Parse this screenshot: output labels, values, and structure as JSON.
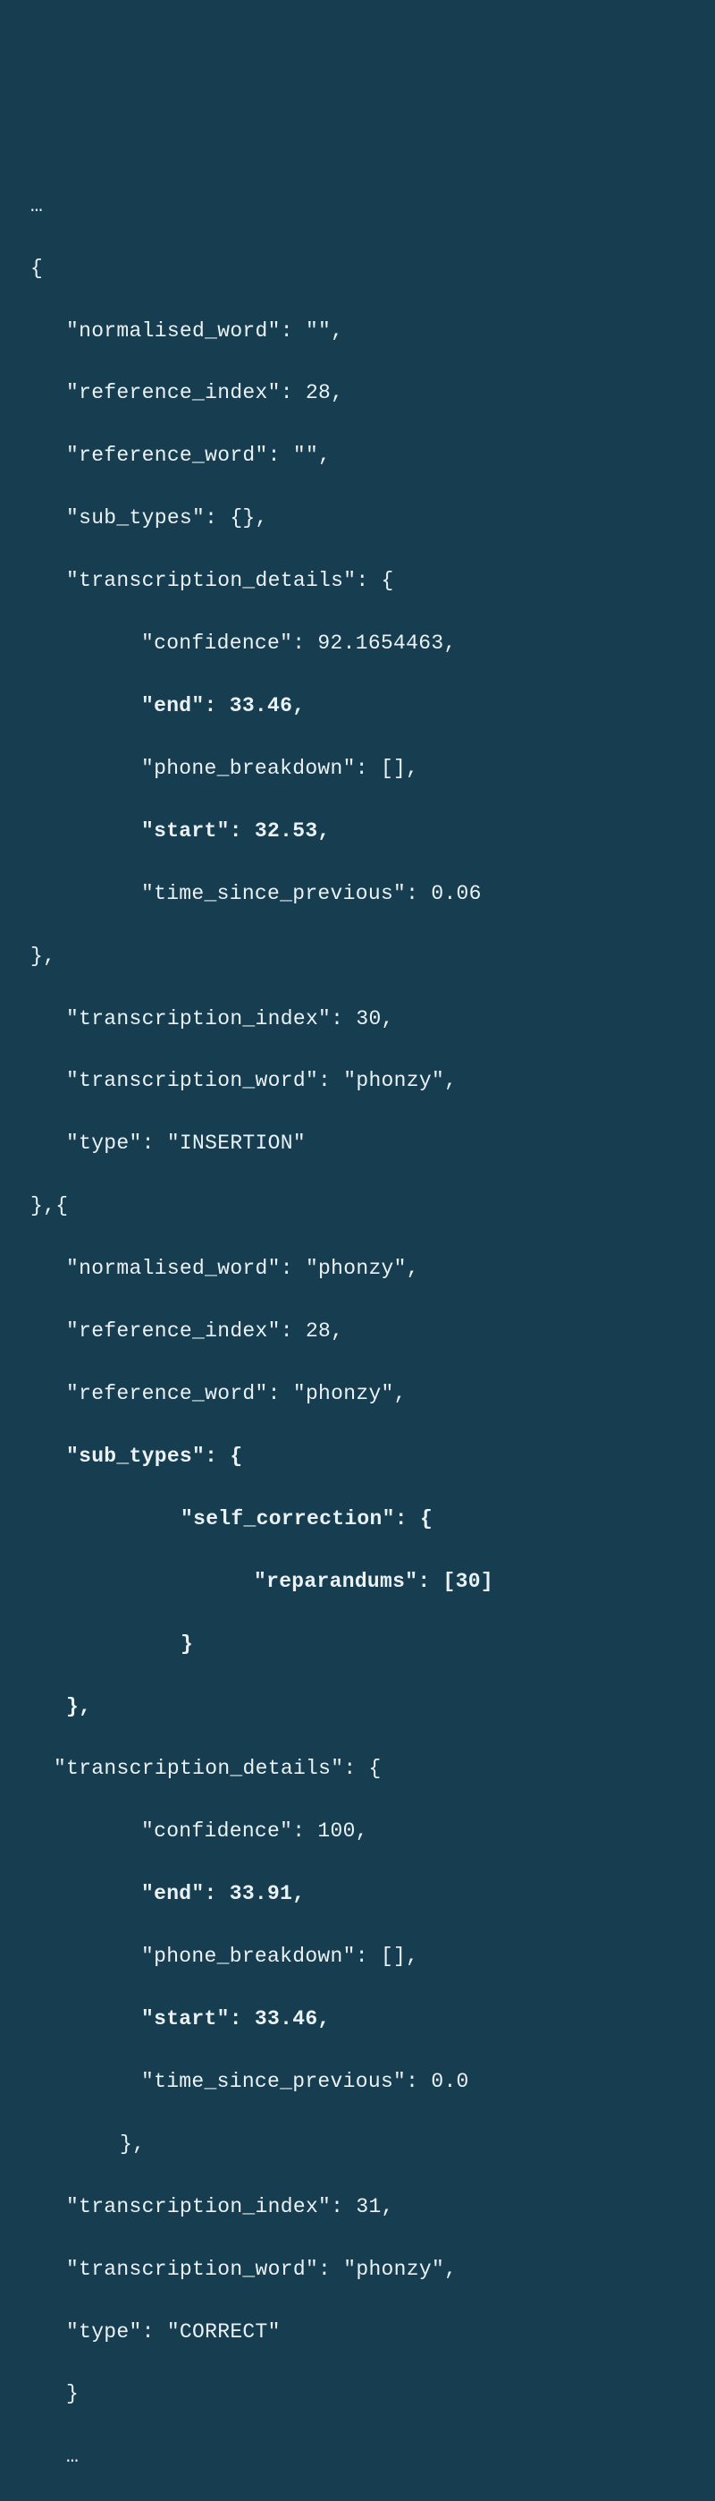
{
  "code": {
    "ellipsis_top": "…",
    "brace_open1": "{",
    "obj1": {
      "k_norm": "\"normalised_word\": \"\",",
      "k_refidx": "\"reference_index\": 28,",
      "k_refword": "\"reference_word\": \"\",",
      "k_subtypes": "\"sub_types\": {},",
      "k_tdetails_open": "\"transcription_details\": {",
      "td": {
        "conf": "\"confidence\": 92.1654463,",
        "end": "\"end\": 33.46,",
        "phone": "\"phone_breakdown\": [],",
        "start": "\"start\": 32.53,",
        "tsp": "\"time_since_previous\": 0.06"
      },
      "brace_close_td": "},",
      "k_tidx": "\"transcription_index\": 30,",
      "k_tword": "\"transcription_word\": \"phonzy\",",
      "k_type": "\"type\": \"INSERTION\""
    },
    "between": "},{",
    "obj2": {
      "k_norm": "\"normalised_word\": \"phonzy\",",
      "k_refidx": "\"reference_index\": 28,",
      "k_refword": "\"reference_word\": \"phonzy\",",
      "k_subtypes_open": "\"sub_types\": {",
      "sc_open": "\"self_correction\": {",
      "reparandums": "\"reparandums\": [30]",
      "sc_close": "}",
      "subtypes_close": "},",
      "k_tdetails_open": "\"transcription_details\": {",
      "td": {
        "conf": "\"confidence\": 100,",
        "end": "\"end\": 33.91,",
        "phone": "\"phone_breakdown\": [],",
        "start": "\"start\": 33.46,",
        "tsp": "\"time_since_previous\": 0.0"
      },
      "brace_close_td": "},",
      "k_tidx": "\"transcription_index\": 31,",
      "k_tword": "\"transcription_word\": \"phonzy\",",
      "k_type": "\"type\": \"CORRECT\""
    },
    "brace_close2": "}",
    "ellipsis_bot": "…"
  }
}
